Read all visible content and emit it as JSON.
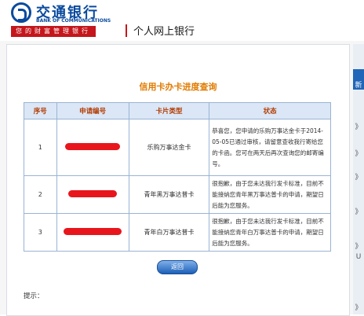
{
  "header": {
    "bank_name_cn": "交通银行",
    "bank_name_en": "BANK OF COMMUNICATIONS",
    "slogan": "您的财富管理银行",
    "portal_title": "个人网上银行"
  },
  "page": {
    "title": "信用卡办卡进度查询",
    "back_button": "返回",
    "tip_label": "提示："
  },
  "table": {
    "headers": [
      "序号",
      "申请编号",
      "卡片类型",
      "状态"
    ],
    "rows": [
      {
        "index": "1",
        "card_type": "乐购万事达金卡",
        "status": "恭喜您，您申请的乐购万事达金卡于2014-05-05已通过审核，请留意查收我行寄给您的卡函。您可在两天后再次查询您的邮寄编号。"
      },
      {
        "index": "2",
        "card_type": "青年黑万事达普卡",
        "status": "很抱歉，由于您未达我行发卡标准，目前不能接纳您青年黑万事达普卡的申请，期望日后能为您服务。"
      },
      {
        "index": "3",
        "card_type": "青年白万事达普卡",
        "status": "很抱歉，由于您未达我行发卡标准，目前不能接纳您青年白万事达普卡的申请，期望日后能为您服务。"
      }
    ]
  },
  "colors": {
    "brand_blue": "#0a4a9e",
    "brand_red": "#c4161c",
    "title_orange": "#e07b00",
    "redaction": "#e8161c"
  },
  "right_strip": {
    "glyphs": [
      "新",
      "》",
      "》",
      "》",
      "》",
      "》",
      "U",
      "》"
    ]
  }
}
